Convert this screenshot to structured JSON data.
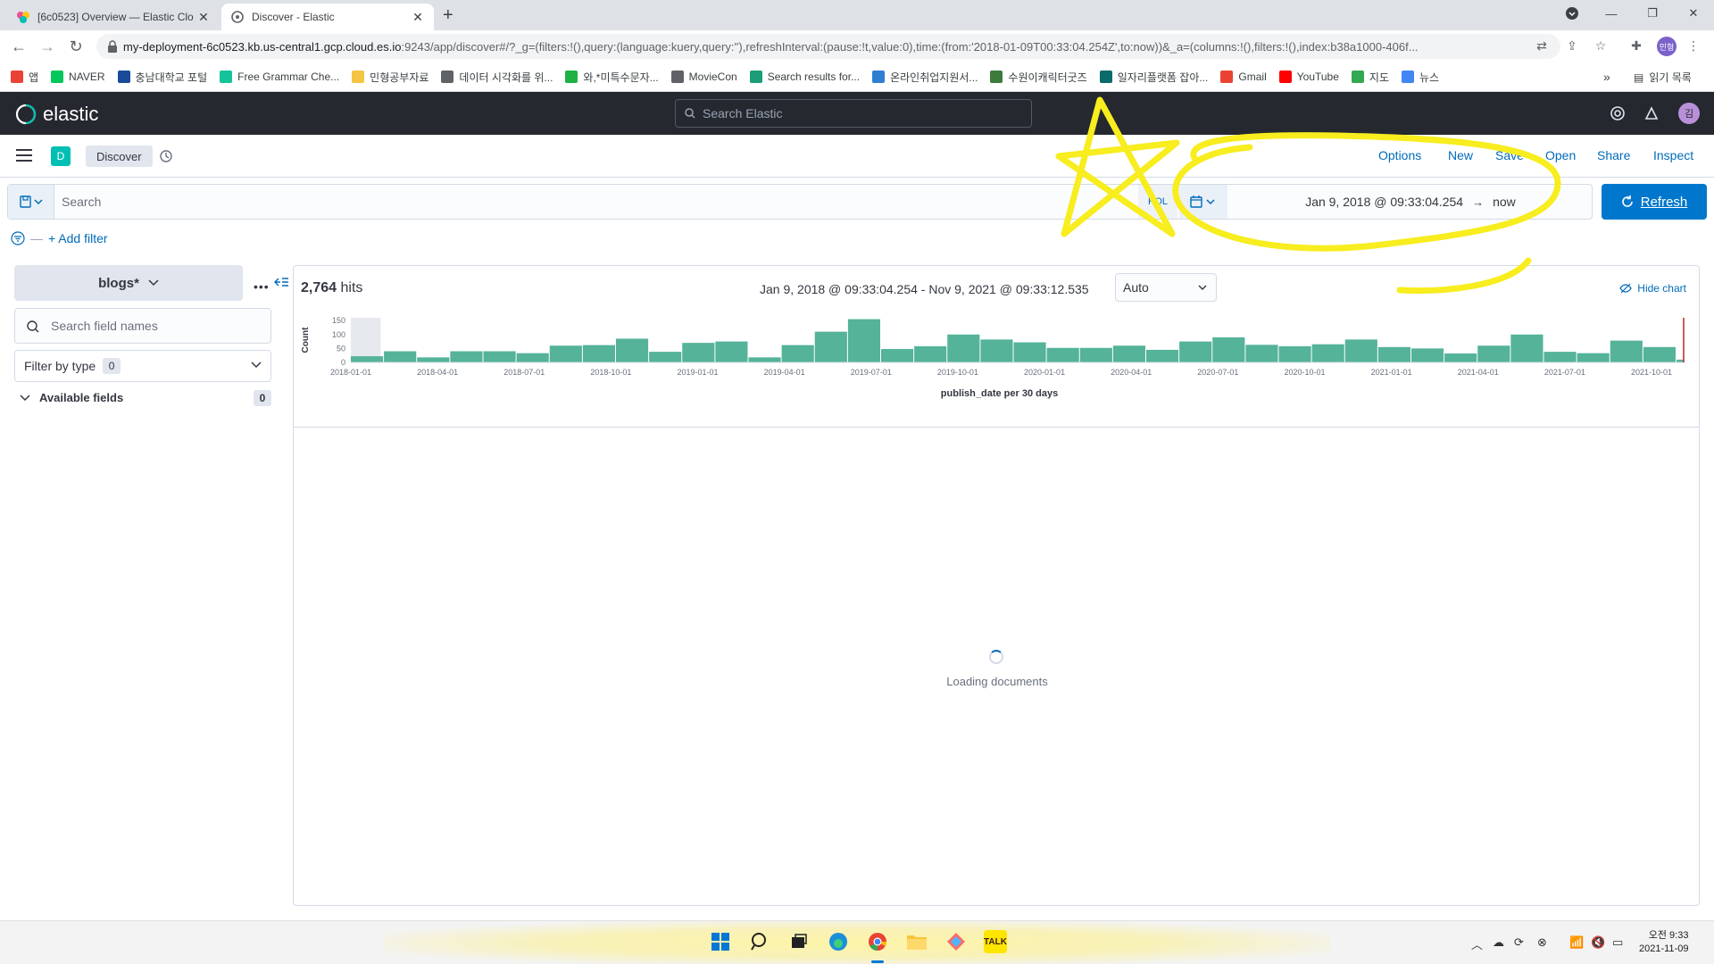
{
  "browser": {
    "tabs": [
      {
        "title": "[6c0523] Overview — Elastic Clo",
        "active": false
      },
      {
        "title": "Discover - Elastic",
        "active": true
      }
    ],
    "url_host": "my-deployment-6c0523.kb.us-central1.gcp.cloud.es.io",
    "url_rest": ":9243/app/discover#/?_g=(filters:!(),query:(language:kuery,query:''),refreshInterval:(pause:!t,value:0),time:(from:'2018-01-09T00:33:04.254Z',to:now))&_a=(columns:!(),filters:!(),index:b38a1000-406f...",
    "profile_initials": "민형",
    "bookmarks": [
      {
        "label": "앱",
        "icon": "apps-icon",
        "color": "#ea4335"
      },
      {
        "label": "NAVER",
        "icon": "naver-icon",
        "color": "#03c75a"
      },
      {
        "label": "충남대학교 포털",
        "icon": "university-icon",
        "color": "#1a4b9b"
      },
      {
        "label": "Free Grammar Che...",
        "icon": "grammar-icon",
        "color": "#15c39a"
      },
      {
        "label": "민형공부자료",
        "icon": "folder-icon",
        "color": "#f4c542"
      },
      {
        "label": "데이터 시각화를 위...",
        "icon": "globe-icon",
        "color": "#5f6368"
      },
      {
        "label": "와,*미특수문자...",
        "icon": "emoji-icon",
        "color": "#1fb141"
      },
      {
        "label": "MovieCon",
        "icon": "globe-icon",
        "color": "#5f6368"
      },
      {
        "label": "Search results for...",
        "icon": "vector-icon",
        "color": "#1b9e77"
      },
      {
        "label": "온라인취업지원서...",
        "icon": "ie-icon",
        "color": "#2f7fd1"
      },
      {
        "label": "수원이캐릭터굿즈",
        "icon": "character-icon",
        "color": "#3d7b3d"
      },
      {
        "label": "일자리플랫폼 잡아...",
        "icon": "job-icon",
        "color": "#0b6a6a"
      },
      {
        "label": "Gmail",
        "icon": "gmail-icon",
        "color": "#ea4335"
      },
      {
        "label": "YouTube",
        "icon": "youtube-icon",
        "color": "#ff0000"
      },
      {
        "label": "지도",
        "icon": "maps-icon",
        "color": "#34a853"
      },
      {
        "label": "뉴스",
        "icon": "news-icon",
        "color": "#4285f4"
      }
    ],
    "bookmarks_more": "»",
    "reading_list": "읽기 목록"
  },
  "elastic": {
    "brand": "elastic",
    "search_placeholder": "Search Elastic",
    "user_initial": "김"
  },
  "app": {
    "space_badge": "D",
    "breadcrumb": "Discover",
    "top_links": [
      "Options",
      "New",
      "Save",
      "Open",
      "Share",
      "Inspect"
    ]
  },
  "query": {
    "placeholder": "Search",
    "language": "KQL",
    "time_from": "Jan 9, 2018 @ 09:33:04.254",
    "time_arrow": "→",
    "time_to": "now",
    "refresh_label": "Refresh",
    "add_filter": "+ Add filter"
  },
  "sidebar": {
    "index_pattern": "blogs*",
    "field_search_placeholder": "Search field names",
    "filter_by_type": "Filter by type",
    "filter_count": "0",
    "available_fields": "Available fields",
    "available_count": "0"
  },
  "main": {
    "hits_count": "2,764",
    "hits_label": "hits",
    "range_text": "Jan 9, 2018 @ 09:33:04.254 - Nov 9, 2021 @ 09:33:12.535",
    "interval": "Auto",
    "hide_chart": "Hide chart",
    "loading": "Loading documents"
  },
  "chart_data": {
    "type": "bar",
    "xlabel": "publish_date per 30 days",
    "ylabel": "Count",
    "ylim": [
      0,
      160
    ],
    "yticks": [
      0,
      50,
      100,
      150
    ],
    "xticks": [
      "2018-01-01",
      "2018-04-01",
      "2018-07-01",
      "2018-10-01",
      "2019-01-01",
      "2019-04-01",
      "2019-07-01",
      "2019-10-01",
      "2020-01-01",
      "2020-04-01",
      "2020-07-01",
      "2020-10-01",
      "2021-01-01",
      "2021-04-01",
      "2021-07-01",
      "2021-10-01"
    ],
    "values": [
      22,
      40,
      18,
      40,
      40,
      33,
      60,
      62,
      85,
      38,
      70,
      75,
      18,
      62,
      110,
      155,
      48,
      58,
      100,
      82,
      72,
      52,
      52,
      60,
      45,
      75,
      90,
      63,
      58,
      65,
      82,
      55,
      50,
      32,
      60,
      100,
      38,
      33,
      78,
      55,
      10
    ],
    "bar_color": "#54b399",
    "grid": false
  },
  "taskbar": {
    "time": "오전 9:33",
    "date": "2021-11-09"
  }
}
